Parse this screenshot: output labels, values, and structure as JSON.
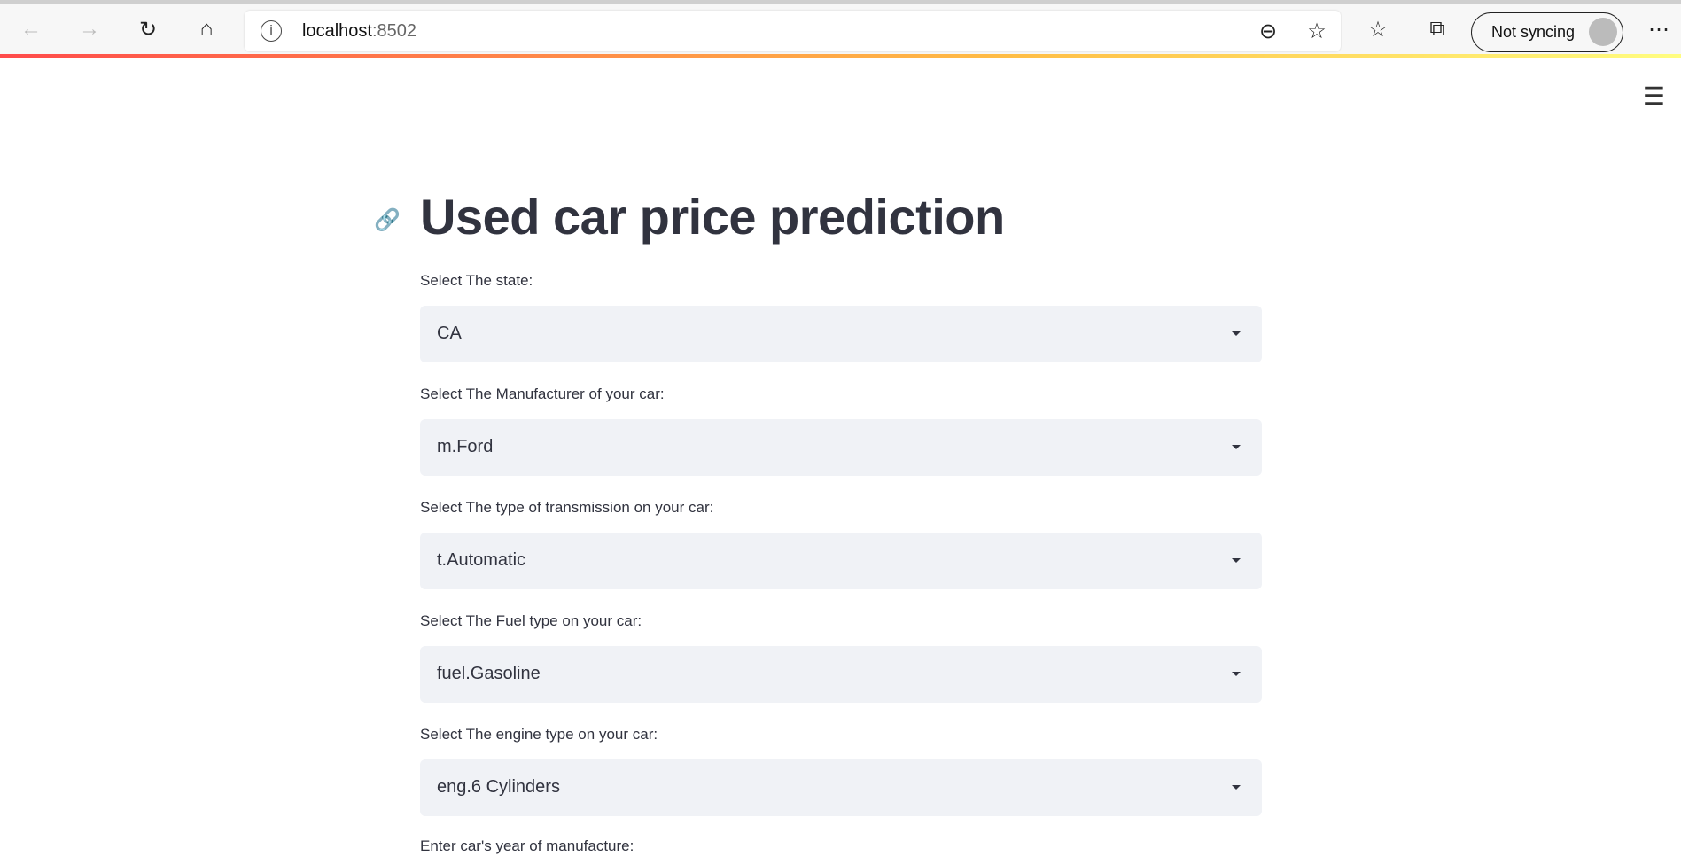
{
  "browser": {
    "url_host": "localhost",
    "url_port": ":8502",
    "sync_label": "Not syncing"
  },
  "page": {
    "title": "Used car price prediction",
    "fields": [
      {
        "label": "Select The state:",
        "value": "CA"
      },
      {
        "label": "Select The Manufacturer of your car:",
        "value": "m.Ford"
      },
      {
        "label": "Select The type of transmission on your car:",
        "value": "t.Automatic"
      },
      {
        "label": "Select The Fuel type on your car:",
        "value": "fuel.Gasoline"
      },
      {
        "label": "Select The engine type on your car:",
        "value": "eng.6 Cylinders"
      }
    ],
    "year_label": "Enter car's year of manufacture:"
  }
}
